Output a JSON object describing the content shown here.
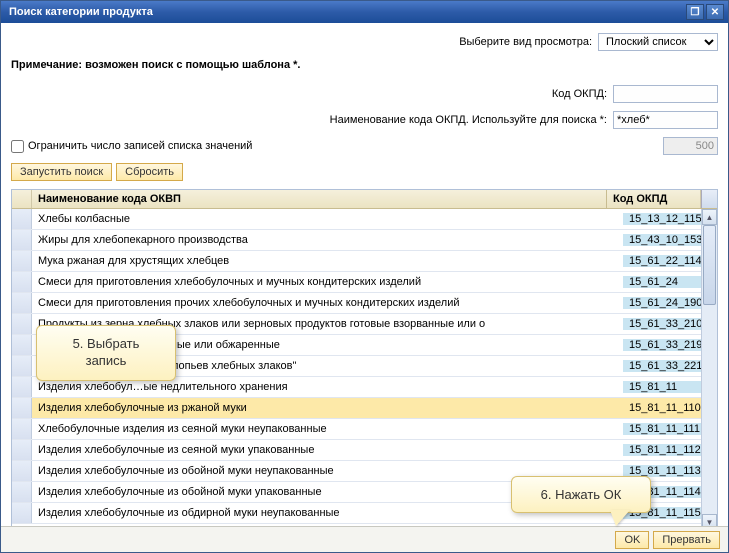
{
  "window": {
    "title": "Поиск категории продукта"
  },
  "view": {
    "label": "Выберите вид просмотра:",
    "selected": "Плоский список"
  },
  "note": "Примечание: возможен поиск с помощью шаблона *.",
  "fields": {
    "code_label": "Код ОКПД:",
    "code_value": "",
    "name_label": "Наименование кода ОКПД. Используйте для поиска *:",
    "name_value": "*хлеб*",
    "limit_label": "Ограничить число записей списка значений",
    "limit_value": "500"
  },
  "buttons": {
    "run": "Запустить поиск",
    "reset": "Сбросить",
    "ok": "OK",
    "cancel": "Прервать"
  },
  "table": {
    "headers": {
      "name": "Наименование кода ОКВП",
      "code": "Код ОКПД"
    },
    "rows": [
      {
        "name": "Хлебы колбасные",
        "code": "15_13_12_115"
      },
      {
        "name": "Жиры для хлебопекарного производства",
        "code": "15_43_10_153"
      },
      {
        "name": "Мука ржаная для хрустящих хлебцев",
        "code": "15_61_22_114"
      },
      {
        "name": "Смеси для приготовления хлебобулочных и мучных кондитерских изделий",
        "code": "15_61_24"
      },
      {
        "name": "Смеси для приготовления прочих хлебобулочных и мучных кондитерских изделий",
        "code": "15_61_24_190"
      },
      {
        "name": "Продукты из зерна хлебных злаков или зерновых продуктов готовые взорванные или о",
        "code": "15_61_33_210"
      },
      {
        "name": "…злаков готовые взорванные или обжаренные",
        "code": "15_61_33_219"
      },
      {
        "name": "…основе необжаренных хлопьев хлебных злаков\"",
        "code": "15_61_33_221"
      },
      {
        "name": "Изделия хлебобул…ые недлительного хранения",
        "code": "15_81_11"
      },
      {
        "name": "Изделия хлебобулочные из ржаной муки",
        "code": "15_81_11_110",
        "selected": true
      },
      {
        "name": "Хлебобулочные изделия из сеяной муки неупакованные",
        "code": "15_81_11_111"
      },
      {
        "name": "Изделия хлебобулочные из сеяной муки упакованные",
        "code": "15_81_11_112"
      },
      {
        "name": "Изделия хлебобулочные из обойной муки неупакованные",
        "code": "15_81_11_113"
      },
      {
        "name": "Изделия хлебобулочные из обойной муки упакованные",
        "code": "15_81_11_114"
      },
      {
        "name": "Изделия хлебобулочные из обдирной муки неупакованные",
        "code": "15_81_11_115"
      }
    ]
  },
  "callouts": {
    "c1_line1": "5. Выбрать",
    "c1_line2": "запись",
    "c2": "6. Нажать ОК"
  }
}
